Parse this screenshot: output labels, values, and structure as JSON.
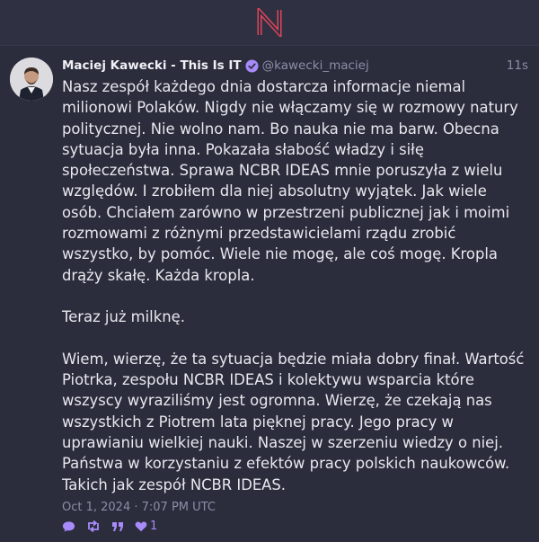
{
  "app": {
    "logo_icon": "nostr-n-logo",
    "accent_color": "#a78bfa",
    "logo_color": "#e0445a"
  },
  "post": {
    "display_name": "Maciej Kawecki - This Is IT",
    "handle": "@kawecki_maciej",
    "relative_time": "11s",
    "body": "Nasz zespół każdego dnia dostarcza informacje niemal milionowi Polaków. Nigdy nie włączamy się w rozmowy natury politycznej. Nie wolno nam. Bo nauka nie ma barw. Obecna sytuacja była inna. Pokazała słabość władzy i siłę społeczeństwa. Sprawa NCBR IDEAS mnie poruszyła z wielu względów. I zrobiłem dla niej absolutny wyjątek. Jak wiele osób. Chciałem zarówno w przestrzeni publicznej jak i moimi rozmowami z różnymi przedstawicielami rządu zrobić wszystko, by pomóc. Wiele nie mogę, ale coś mogę. Kropla drąży skałę. Każda kropla.\n\nTeraz już milknę.\n\nWiem, wierzę, że ta sytuacja będzie miała dobry finał. Wartość Piotrka, zespołu NCBR IDEAS i kolektywu wsparcia które wszyscy wyraziliśmy jest ogromna. Wierzę, że czekają nas wszystkich z Piotrem lata pięknej pracy. Jego pracy w uprawianiu wielkiej nauki. Naszej w szerzeniu wiedzy o niej. Państwa w korzystaniu z efektów pracy polskich naukowców. Takich jak zespół NCBR IDEAS.",
    "timestamp": "Oct 1, 2024 · 7:07 PM UTC",
    "like_count": "1"
  }
}
